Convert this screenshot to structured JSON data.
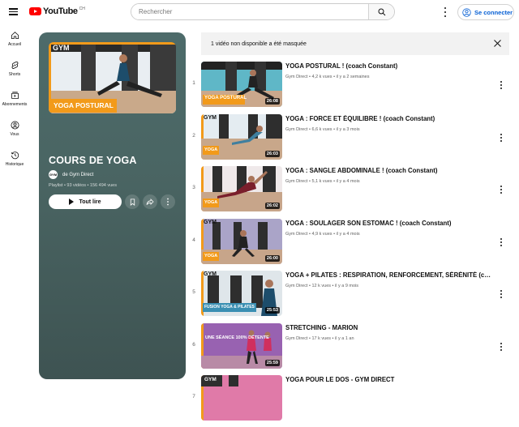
{
  "header": {
    "logo_text": "YouTube",
    "country_code": "CH",
    "search_placeholder": "Rechercher",
    "signin_label": "Se connecter"
  },
  "sidebar": {
    "items": [
      {
        "label": "Accueil",
        "icon": "home-icon"
      },
      {
        "label": "Shorts",
        "icon": "shorts-icon"
      },
      {
        "label": "Abonnements",
        "icon": "subscriptions-icon"
      },
      {
        "label": "Vous",
        "icon": "you-icon"
      },
      {
        "label": "Historique",
        "icon": "history-icon"
      }
    ]
  },
  "playlist": {
    "title": "COURS DE YOGA",
    "channel": "de Gym Direct",
    "avatar_text": "GYM",
    "meta": "Playlist • 93 vidéos • 156 494 vues",
    "play_label": "Tout lire",
    "thumb_brand": "GYM",
    "thumb_caption": "YOGA POSTURAL",
    "bg_color": "#4a6563"
  },
  "banner": {
    "text": "1 vidéo non disponible a été masquée"
  },
  "videos": [
    {
      "index": "1",
      "title": "YOGA POSTURAL ! (coach Constant)",
      "meta": "Gym Direct • 4,2 k vues • il y a 2 semaines",
      "duration": "26:08",
      "caption": "YOGA POSTURAL"
    },
    {
      "index": "2",
      "title": "YOGA : FORCE ET ÉQUILIBRE ! (coach Constant)",
      "meta": "Gym Direct • 6,6 k vues • il y a 3 mois",
      "duration": "26:03",
      "caption": "YOGA"
    },
    {
      "index": "3",
      "title": "YOGA : SANGLE ABDOMINALE ! (coach Constant)",
      "meta": "Gym Direct • 5,1 k vues • il y a 4 mois",
      "duration": "26:02",
      "caption": "YOGA"
    },
    {
      "index": "4",
      "title": "YOGA : SOULAGER SON ESTOMAC ! (coach Constant)",
      "meta": "Gym Direct • 4,9 k vues • il y a 4 mois",
      "duration": "26:00",
      "caption": "YOGA"
    },
    {
      "index": "5",
      "title": "YOGA + PILATES : RESPIRATION, RENFORCEMENT, SÉRÉNITÉ (coach Constant)",
      "meta": "Gym Direct • 12 k vues • il y a 9 mois",
      "duration": "25:53",
      "caption": "FUSION YOGA & PILATES"
    },
    {
      "index": "6",
      "title": "STRETCHING - MARION",
      "meta": "Gym Direct • 17 k vues • il y a 1 an",
      "duration": "25:59",
      "caption": "UNE SÉANCE 100% DÉTENTE"
    },
    {
      "index": "7",
      "title": "YOGA POUR LE DOS - GYM DIRECT",
      "meta": "",
      "duration": "",
      "caption": ""
    }
  ]
}
